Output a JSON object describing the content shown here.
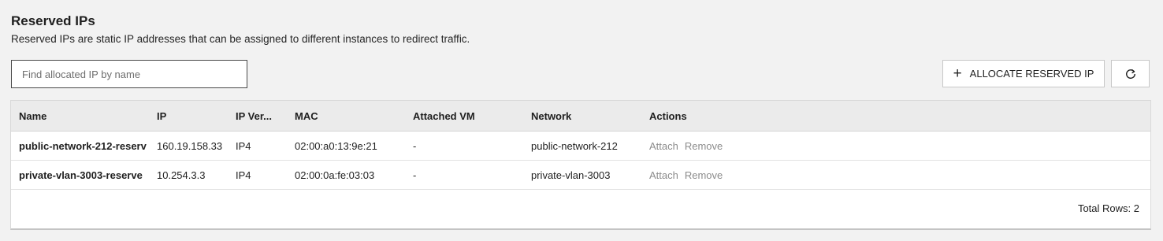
{
  "page": {
    "title": "Reserved IPs",
    "subtitle": "Reserved IPs are static IP addresses that can be assigned to different instances to redirect traffic."
  },
  "search": {
    "placeholder": "Find allocated IP by name",
    "value": ""
  },
  "toolbar": {
    "allocate_label": "ALLOCATE RESERVED IP",
    "allocate_icon": "plus-icon",
    "refresh_icon": "refresh-icon"
  },
  "table": {
    "columns": [
      "Name",
      "IP",
      "IP Ver...",
      "MAC",
      "Attached VM",
      "Network",
      "Actions"
    ],
    "rows": [
      {
        "name": "public-network-212-reserv",
        "ip": "160.19.158.33",
        "ip_version": "IP4",
        "mac": "02:00:a0:13:9e:21",
        "attached_vm": "-",
        "network": "public-network-212",
        "actions": [
          "Attach",
          "Remove"
        ]
      },
      {
        "name": "private-vlan-3003-reserve",
        "ip": "10.254.3.3",
        "ip_version": "IP4",
        "mac": "02:00:0a:fe:03:03",
        "attached_vm": "-",
        "network": "private-vlan-3003",
        "actions": [
          "Attach",
          "Remove"
        ]
      }
    ],
    "footer": "Total Rows: 2"
  },
  "colors": {
    "background": "#f2f2f2",
    "header_bg": "#ebebeb",
    "action_text": "#8c8c8c"
  }
}
